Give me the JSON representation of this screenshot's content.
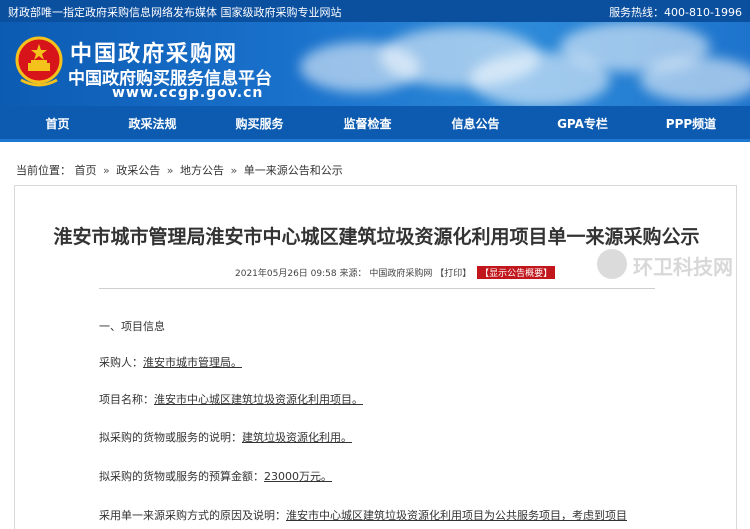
{
  "topbar": {
    "left_text": "财政部唯一指定政府采购信息网络发布媒体 国家级政府采购专业网站",
    "hotline": "服务热线：400-810-1996"
  },
  "header": {
    "site_name": "中国政府采购网",
    "site_subtitle": "中国政府购买服务信息平台",
    "site_url": "www.ccgp.gov.cn"
  },
  "nav": {
    "items": [
      {
        "label": "首页"
      },
      {
        "label": "政采法规"
      },
      {
        "label": "购买服务"
      },
      {
        "label": "监督检查"
      },
      {
        "label": "信息公告"
      },
      {
        "label": "GPA专栏"
      },
      {
        "label": "PPP频道"
      }
    ]
  },
  "breadcrumb": {
    "prefix": "当前位置：",
    "items": [
      "首页",
      "政采公告",
      "地方公告",
      "单一来源公告和公示"
    ],
    "separator": "»"
  },
  "article": {
    "title": "淮安市城市管理局淮安市中心城区建筑垃圾资源化利用项目单一来源采购公示",
    "datetime": "2021年05月26日 09:58",
    "source_label": "来源：",
    "source": "中国政府采购网",
    "print_label": "【打印】",
    "summary_button": "【显示公告概要】",
    "watermark_text": "环卫科技网",
    "section1": "一、项目信息",
    "fields": [
      {
        "label": "采购人：",
        "value": "淮安市城市管理局。"
      },
      {
        "label": "项目名称：",
        "value": "淮安市中心城区建筑垃圾资源化利用项目。"
      },
      {
        "label": "拟采购的货物或服务的说明：",
        "value": "建筑垃圾资源化利用。"
      },
      {
        "label": "拟采购的货物或服务的预算金额：",
        "value": "23000万元。"
      },
      {
        "label": "采用单一来源采购方式的原因及说明：",
        "value": "淮安市中心城区建筑垃圾资源化利用项目为公共服务项目，考虑到项目"
      }
    ]
  },
  "colors": {
    "topbar": "#0b4f9f",
    "nav": "#0d5bb0",
    "summary_button": "#c0161c"
  }
}
